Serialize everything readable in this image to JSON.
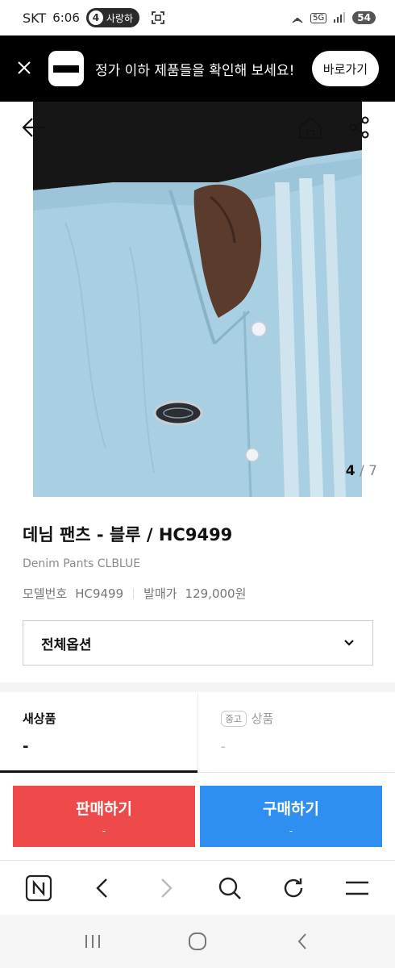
{
  "status_bar": {
    "carrier": "SKT",
    "time": "6:06",
    "notification_count": "4",
    "notification_text": "사랑하",
    "network": "5G",
    "battery": "54"
  },
  "promo": {
    "message": "정가 이하 제품들을 확인해 보세요!",
    "button": "바로가기"
  },
  "product": {
    "image_index": "4",
    "image_total": "/ 7",
    "title": "데님 팬츠 - 블루 / HC9499",
    "subtitle": "Denim Pants CLBLUE",
    "model_label": "모델번호",
    "model_value": "HC9499",
    "release_price_label": "발매가",
    "release_price_value": "129,000원",
    "option_label": "전체옵션"
  },
  "tabs": {
    "new_label": "새상품",
    "new_value": "-",
    "used_badge": "중고",
    "used_label": "상품",
    "used_value": "-"
  },
  "actions": {
    "sell_label": "판매하기",
    "sell_sub": "-",
    "buy_label": "구매하기",
    "buy_sub": "-"
  },
  "colors": {
    "sell": "#ef4a4a",
    "buy": "#2f8ff0",
    "denim": "#a9cfe3"
  },
  "icons": [
    "back-arrow-icon",
    "home-icon",
    "share-icon",
    "chevron-down-icon",
    "n-logo-icon",
    "browser-back-icon",
    "browser-forward-icon",
    "search-icon",
    "refresh-icon",
    "menu-icon",
    "recents-icon",
    "home-circle-icon",
    "system-back-icon"
  ]
}
